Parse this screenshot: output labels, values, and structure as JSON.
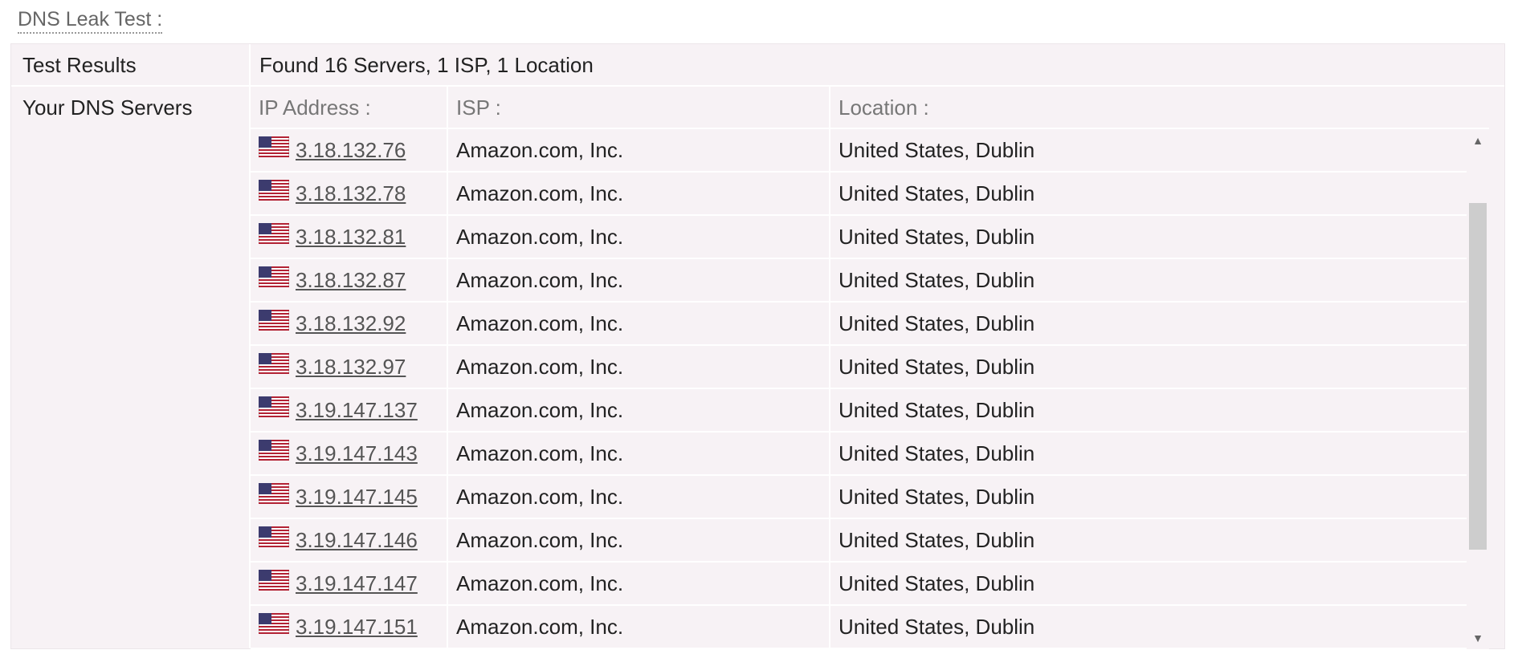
{
  "title": "DNS Leak Test :",
  "test_results": {
    "label": "Test Results",
    "value": "Found 16 Servers, 1 ISP, 1 Location"
  },
  "dns_servers": {
    "label": "Your DNS Servers",
    "columns": {
      "ip": "IP Address :",
      "isp": "ISP :",
      "location": "Location :"
    },
    "rows": [
      {
        "ip": "3.18.132.76",
        "isp": "Amazon.com, Inc.",
        "location": "United States, Dublin"
      },
      {
        "ip": "3.18.132.78",
        "isp": "Amazon.com, Inc.",
        "location": "United States, Dublin"
      },
      {
        "ip": "3.18.132.81",
        "isp": "Amazon.com, Inc.",
        "location": "United States, Dublin"
      },
      {
        "ip": "3.18.132.87",
        "isp": "Amazon.com, Inc.",
        "location": "United States, Dublin"
      },
      {
        "ip": "3.18.132.92",
        "isp": "Amazon.com, Inc.",
        "location": "United States, Dublin"
      },
      {
        "ip": "3.18.132.97",
        "isp": "Amazon.com, Inc.",
        "location": "United States, Dublin"
      },
      {
        "ip": "3.19.147.137",
        "isp": "Amazon.com, Inc.",
        "location": "United States, Dublin"
      },
      {
        "ip": "3.19.147.143",
        "isp": "Amazon.com, Inc.",
        "location": "United States, Dublin"
      },
      {
        "ip": "3.19.147.145",
        "isp": "Amazon.com, Inc.",
        "location": "United States, Dublin"
      },
      {
        "ip": "3.19.147.146",
        "isp": "Amazon.com, Inc.",
        "location": "United States, Dublin"
      },
      {
        "ip": "3.19.147.147",
        "isp": "Amazon.com, Inc.",
        "location": "United States, Dublin"
      },
      {
        "ip": "3.19.147.151",
        "isp": "Amazon.com, Inc.",
        "location": "United States, Dublin"
      }
    ]
  },
  "icons": {
    "flag": "us-flag-icon",
    "scroll_up": "scroll-up-arrow-icon",
    "scroll_down": "scroll-down-arrow-icon"
  },
  "colors": {
    "table_bg": "#f7f2f5",
    "link": "#555555",
    "heading": "#777777",
    "scroll_thumb": "#cdcdcd"
  }
}
